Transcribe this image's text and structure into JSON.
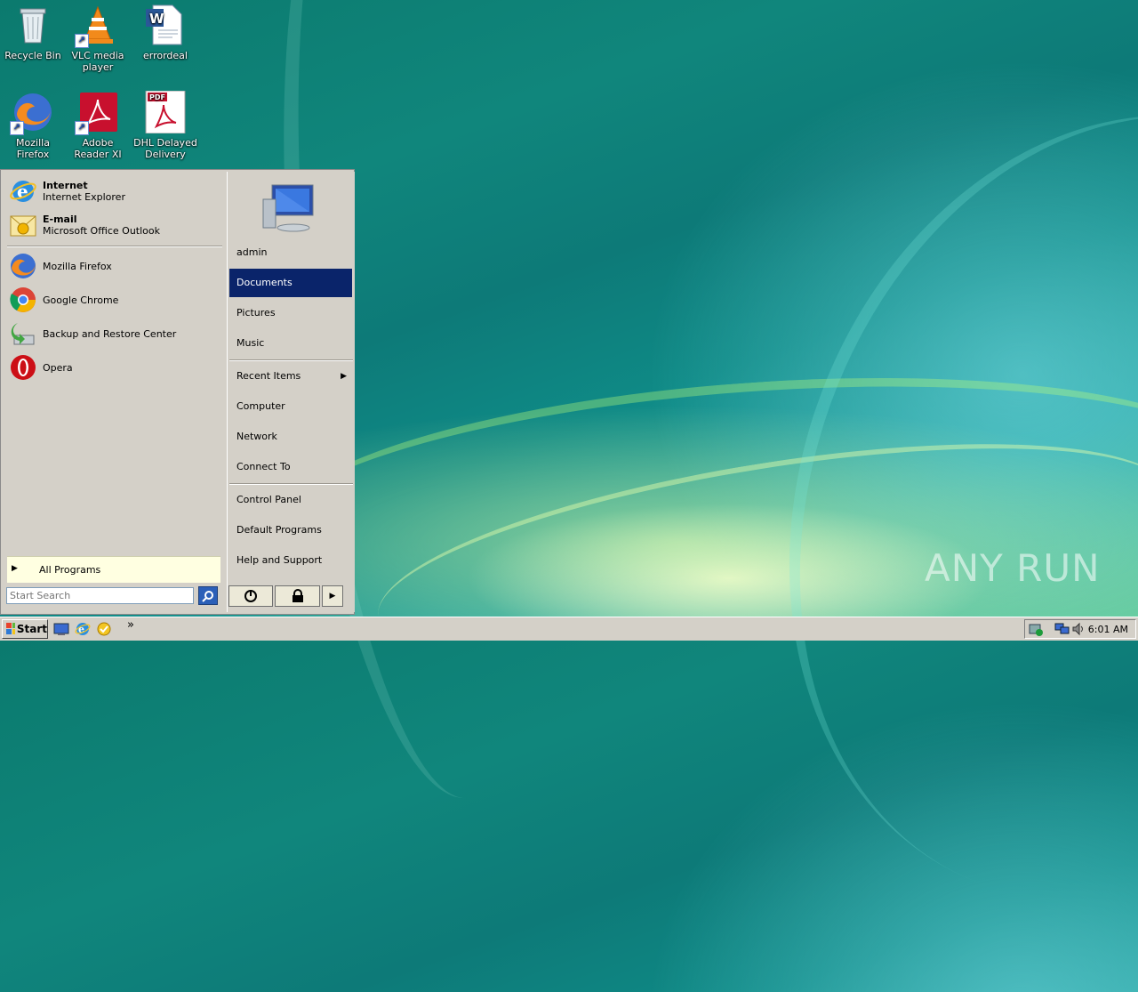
{
  "desktop": {
    "icons": [
      {
        "label": "Recycle Bin",
        "icon": "recycle-bin-icon"
      },
      {
        "label": "VLC media player",
        "icon": "vlc-icon"
      },
      {
        "label": "errordeal",
        "icon": "word-document-icon"
      },
      {
        "label": "Mozilla Firefox",
        "icon": "firefox-icon"
      },
      {
        "label": "Adobe Reader XI",
        "icon": "adobe-reader-icon"
      },
      {
        "label": "DHL Delayed Delivery",
        "icon": "pdf-document-icon"
      }
    ],
    "watermark": "ANY RUN"
  },
  "start_menu": {
    "pinned": [
      {
        "title": "Internet",
        "subtitle": "Internet Explorer",
        "icon": "internet-explorer-icon"
      },
      {
        "title": "E-mail",
        "subtitle": "Microsoft Office Outlook",
        "icon": "email-icon"
      }
    ],
    "recent": [
      {
        "label": "Mozilla Firefox",
        "icon": "firefox-icon"
      },
      {
        "label": "Google Chrome",
        "icon": "chrome-icon"
      },
      {
        "label": "Backup and Restore Center",
        "icon": "backup-icon"
      },
      {
        "label": "Opera",
        "icon": "opera-icon"
      }
    ],
    "all_programs": "All Programs",
    "search_placeholder": "Start Search",
    "right_items": [
      {
        "label": "admin"
      },
      {
        "label": "Documents",
        "selected": true
      },
      {
        "label": "Pictures"
      },
      {
        "label": "Music"
      },
      {
        "label": "Recent Items",
        "submenu": true
      },
      {
        "label": "Computer"
      },
      {
        "label": "Network"
      },
      {
        "label": "Connect To"
      },
      {
        "label": "Control Panel"
      },
      {
        "label": "Default Programs"
      },
      {
        "label": "Help and Support"
      }
    ]
  },
  "taskbar": {
    "start_label": "Start",
    "quick_launch": [
      "show-desktop-icon",
      "internet-explorer-icon",
      "outlook-icon"
    ],
    "overflow": "»",
    "clock": "6:01 AM"
  }
}
